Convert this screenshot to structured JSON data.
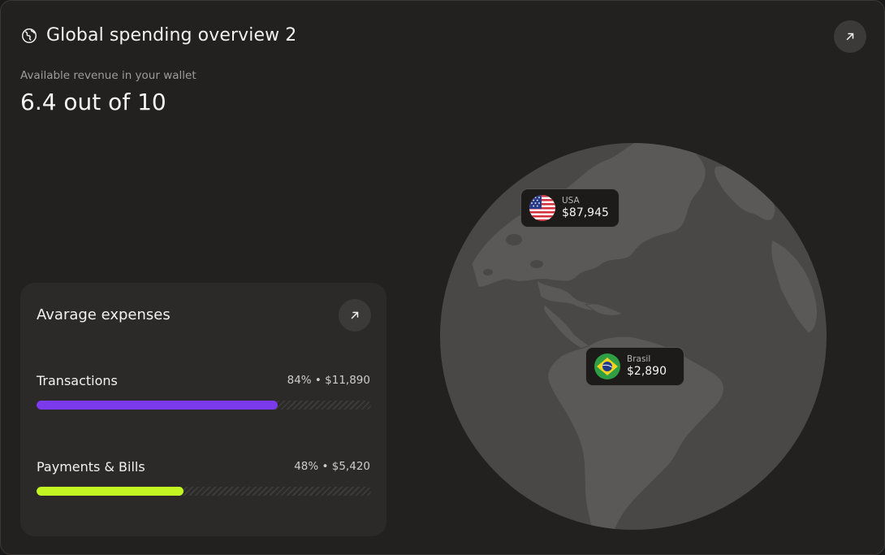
{
  "header": {
    "title": "Global spending overview 2",
    "subtitle": "Available revenue in your wallet",
    "score": "6.4 out of 10"
  },
  "map_pins": [
    {
      "country": "USA",
      "amount": "$87,945"
    },
    {
      "country": "Brasil",
      "amount": "$2,890"
    }
  ],
  "expenses": {
    "title": "Avarage expenses",
    "rows": [
      {
        "label": "Transactions",
        "value": "84% • $11,890",
        "percent": 0.72,
        "color": "#7c3aed"
      },
      {
        "label": "Payments & Bills",
        "value": "48% • $5,420",
        "percent": 0.44,
        "color": "#c3f523"
      }
    ]
  },
  "icons": {
    "title_icon": "globe-icon",
    "action_icon": "arrow-up-right-icon"
  },
  "colors": {
    "background": "#222120",
    "globe": "#4a4846",
    "land": "#5a5856"
  }
}
